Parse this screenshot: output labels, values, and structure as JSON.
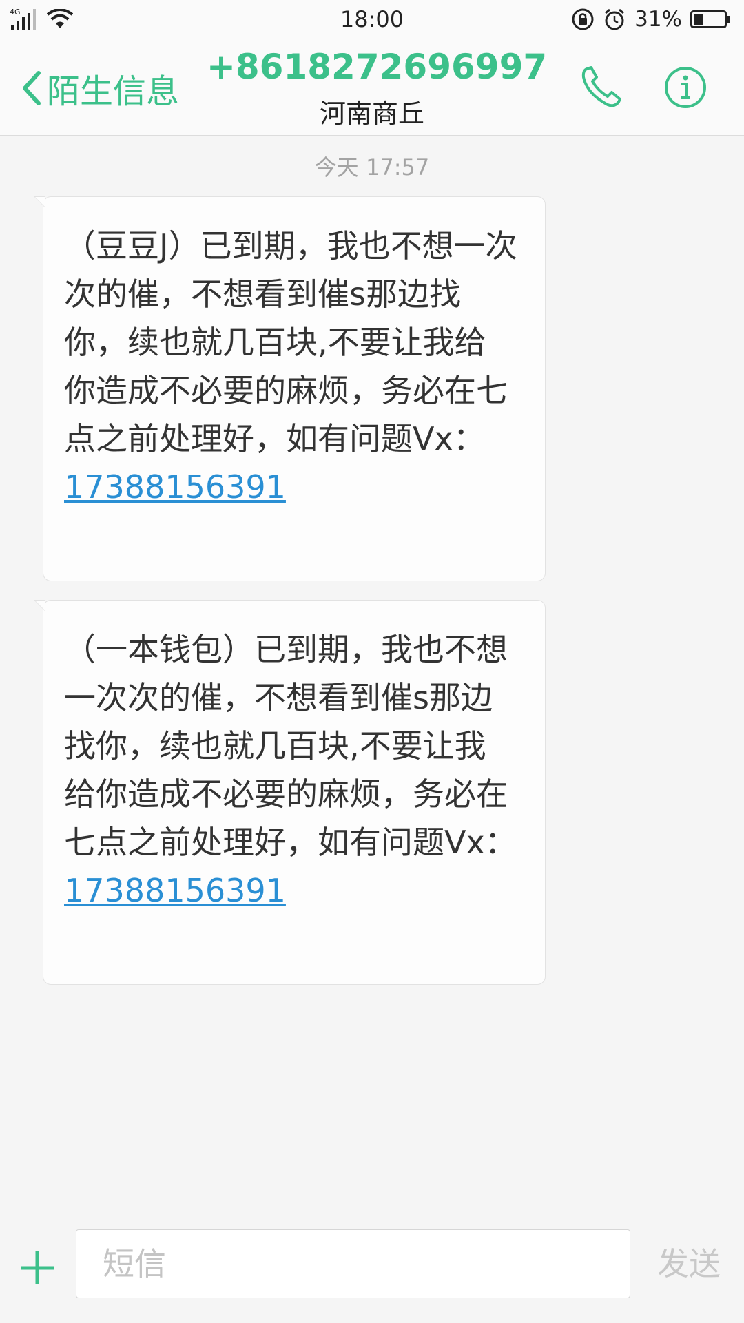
{
  "status_bar": {
    "network": "4G",
    "time": "18:00",
    "battery_percent": "31%",
    "battery_level": 0.31
  },
  "header": {
    "back_label": "陌生信息",
    "contact_number": "+8618272696997",
    "contact_location": "河南商丘"
  },
  "thread": {
    "timestamp": "今天 17:57",
    "messages": [
      {
        "text": "（豆豆J）已到期，我也不想一次次的催，不想看到催s那边找你，续也就几百块,不要让我给你造成不必要的麻烦，务必在七点之前处理好，如有问题Vx：",
        "link": "17388156391"
      },
      {
        "text": "（一本钱包）已到期，我也不想一次次的催，不想看到催s那边找你，续也就几百块,不要让我给你造成不必要的麻烦，务必在七点之前处理好，如有问题Vx：",
        "link": "17388156391"
      }
    ]
  },
  "composer": {
    "placeholder": "短信",
    "send_label": "发送"
  },
  "colors": {
    "accent": "#3cc08a",
    "link": "#2a8fd4",
    "background": "#f5f5f5"
  }
}
